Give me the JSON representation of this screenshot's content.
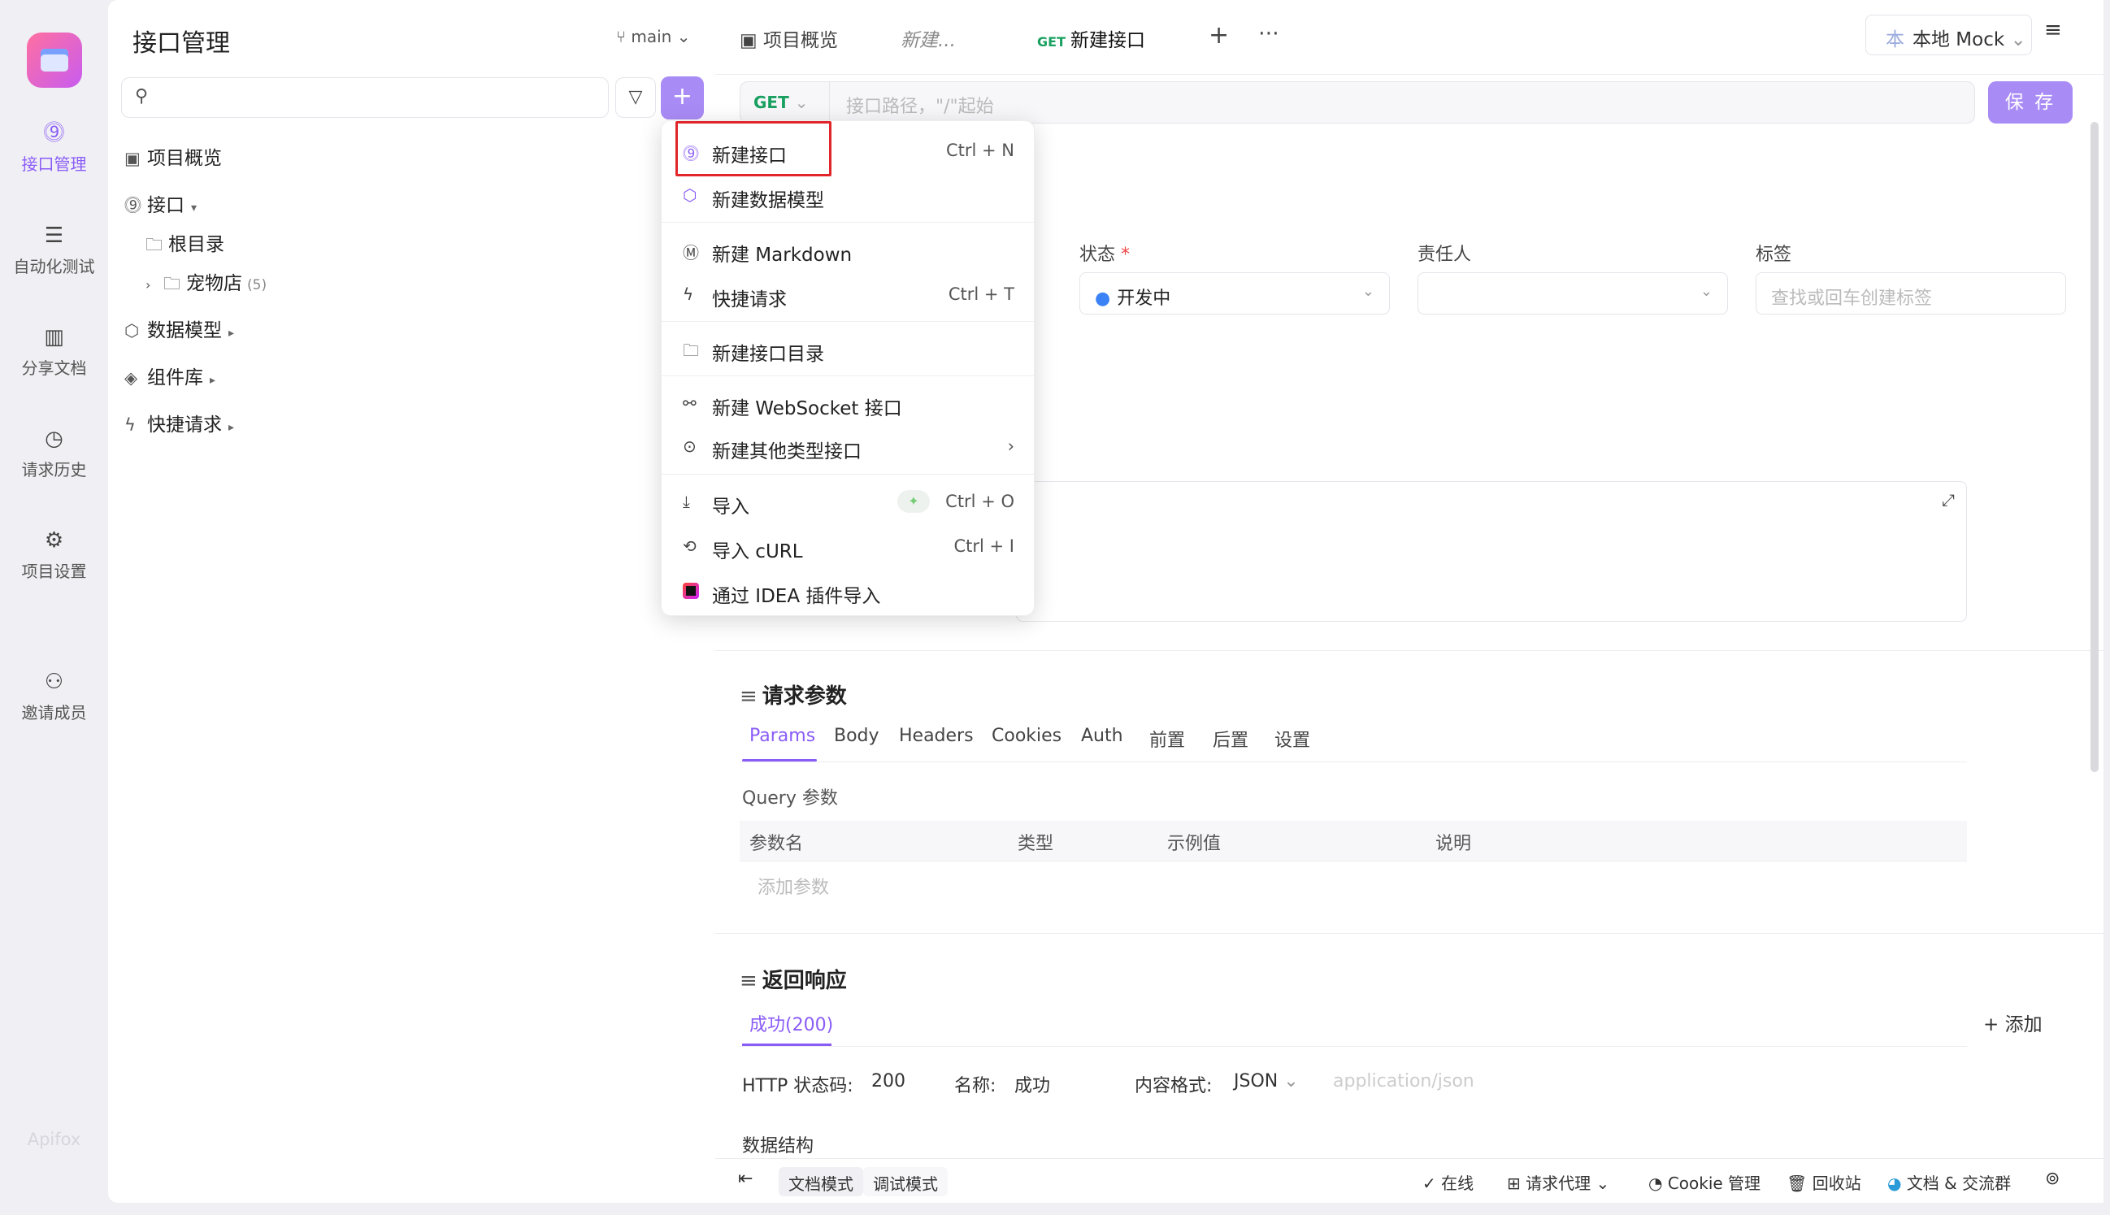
{
  "rail": {
    "items": [
      {
        "label": "接口管理",
        "icon": "api-icon"
      },
      {
        "label": "自动化测试",
        "icon": "layers-icon"
      },
      {
        "label": "分享文档",
        "icon": "book-icon"
      },
      {
        "label": "请求历史",
        "icon": "clock-icon"
      },
      {
        "label": "项目设置",
        "icon": "gear-icon"
      },
      {
        "label": "邀请成员",
        "icon": "user-plus-icon"
      }
    ],
    "brand": "Apifox"
  },
  "sidebar": {
    "title": "接口管理",
    "branch": "main",
    "tree": [
      {
        "label": "项目概览"
      },
      {
        "label": "接口"
      },
      {
        "label": "根目录"
      },
      {
        "label": "宠物店",
        "count": "(5)"
      },
      {
        "label": "数据模型"
      },
      {
        "label": "组件库"
      },
      {
        "label": "快捷请求"
      }
    ]
  },
  "tabs": {
    "overview": "项目概览",
    "draft": "新建...",
    "current_method": "GET",
    "current": "新建接口"
  },
  "mock": {
    "badge": "本",
    "label": "本地 Mock"
  },
  "url": {
    "method": "GET",
    "placeholder": "接口路径，\"/\"起始",
    "save": "保 存"
  },
  "form": {
    "status_label": "状态",
    "status_required": "*",
    "status_value": "开发中",
    "owner_label": "责任人",
    "tags_label": "标签",
    "tags_placeholder": "查找或回车创建标签"
  },
  "request": {
    "title": "请求参数",
    "tabs": [
      "Params",
      "Body",
      "Headers",
      "Cookies",
      "Auth",
      "前置",
      "后置",
      "设置"
    ],
    "query_label": "Query 参数",
    "columns": [
      "参数名",
      "类型",
      "示例值",
      "说明"
    ],
    "add_param": "添加参数"
  },
  "response": {
    "title": "返回响应",
    "tab": "成功(200)",
    "add": "添加",
    "http_code_label": "HTTP 状态码:",
    "http_code": "200",
    "name_label": "名称:",
    "name": "成功",
    "format_label": "内容格式:",
    "format": "JSON",
    "content_type": "application/json",
    "schema_label": "数据结构"
  },
  "statusbar": {
    "doc_mode": "文档模式",
    "debug_mode": "调试模式",
    "online": "在线",
    "proxy": "请求代理",
    "cookie": "Cookie 管理",
    "trash": "回收站",
    "community": "文档 & 交流群"
  },
  "menu": {
    "items": [
      {
        "label": "新建接口",
        "shortcut": "Ctrl + N"
      },
      {
        "label": "新建数据模型",
        "shortcut": ""
      },
      {
        "label": "新建 Markdown",
        "shortcut": ""
      },
      {
        "label": "快捷请求",
        "shortcut": "Ctrl + T"
      },
      {
        "label": "新建接口目录",
        "shortcut": ""
      },
      {
        "label": "新建 WebSocket 接口",
        "shortcut": ""
      },
      {
        "label": "新建其他类型接口",
        "shortcut": "›"
      },
      {
        "label": "导入",
        "shortcut": "Ctrl + O"
      },
      {
        "label": "导入 cURL",
        "shortcut": "Ctrl + I"
      },
      {
        "label": "通过 IDEA 插件导入",
        "shortcut": ""
      }
    ]
  },
  "colors": {
    "accent": "#8a5cf6",
    "button": "#a98bf6",
    "get": "#1aa060",
    "highlight": "#e0262b"
  }
}
